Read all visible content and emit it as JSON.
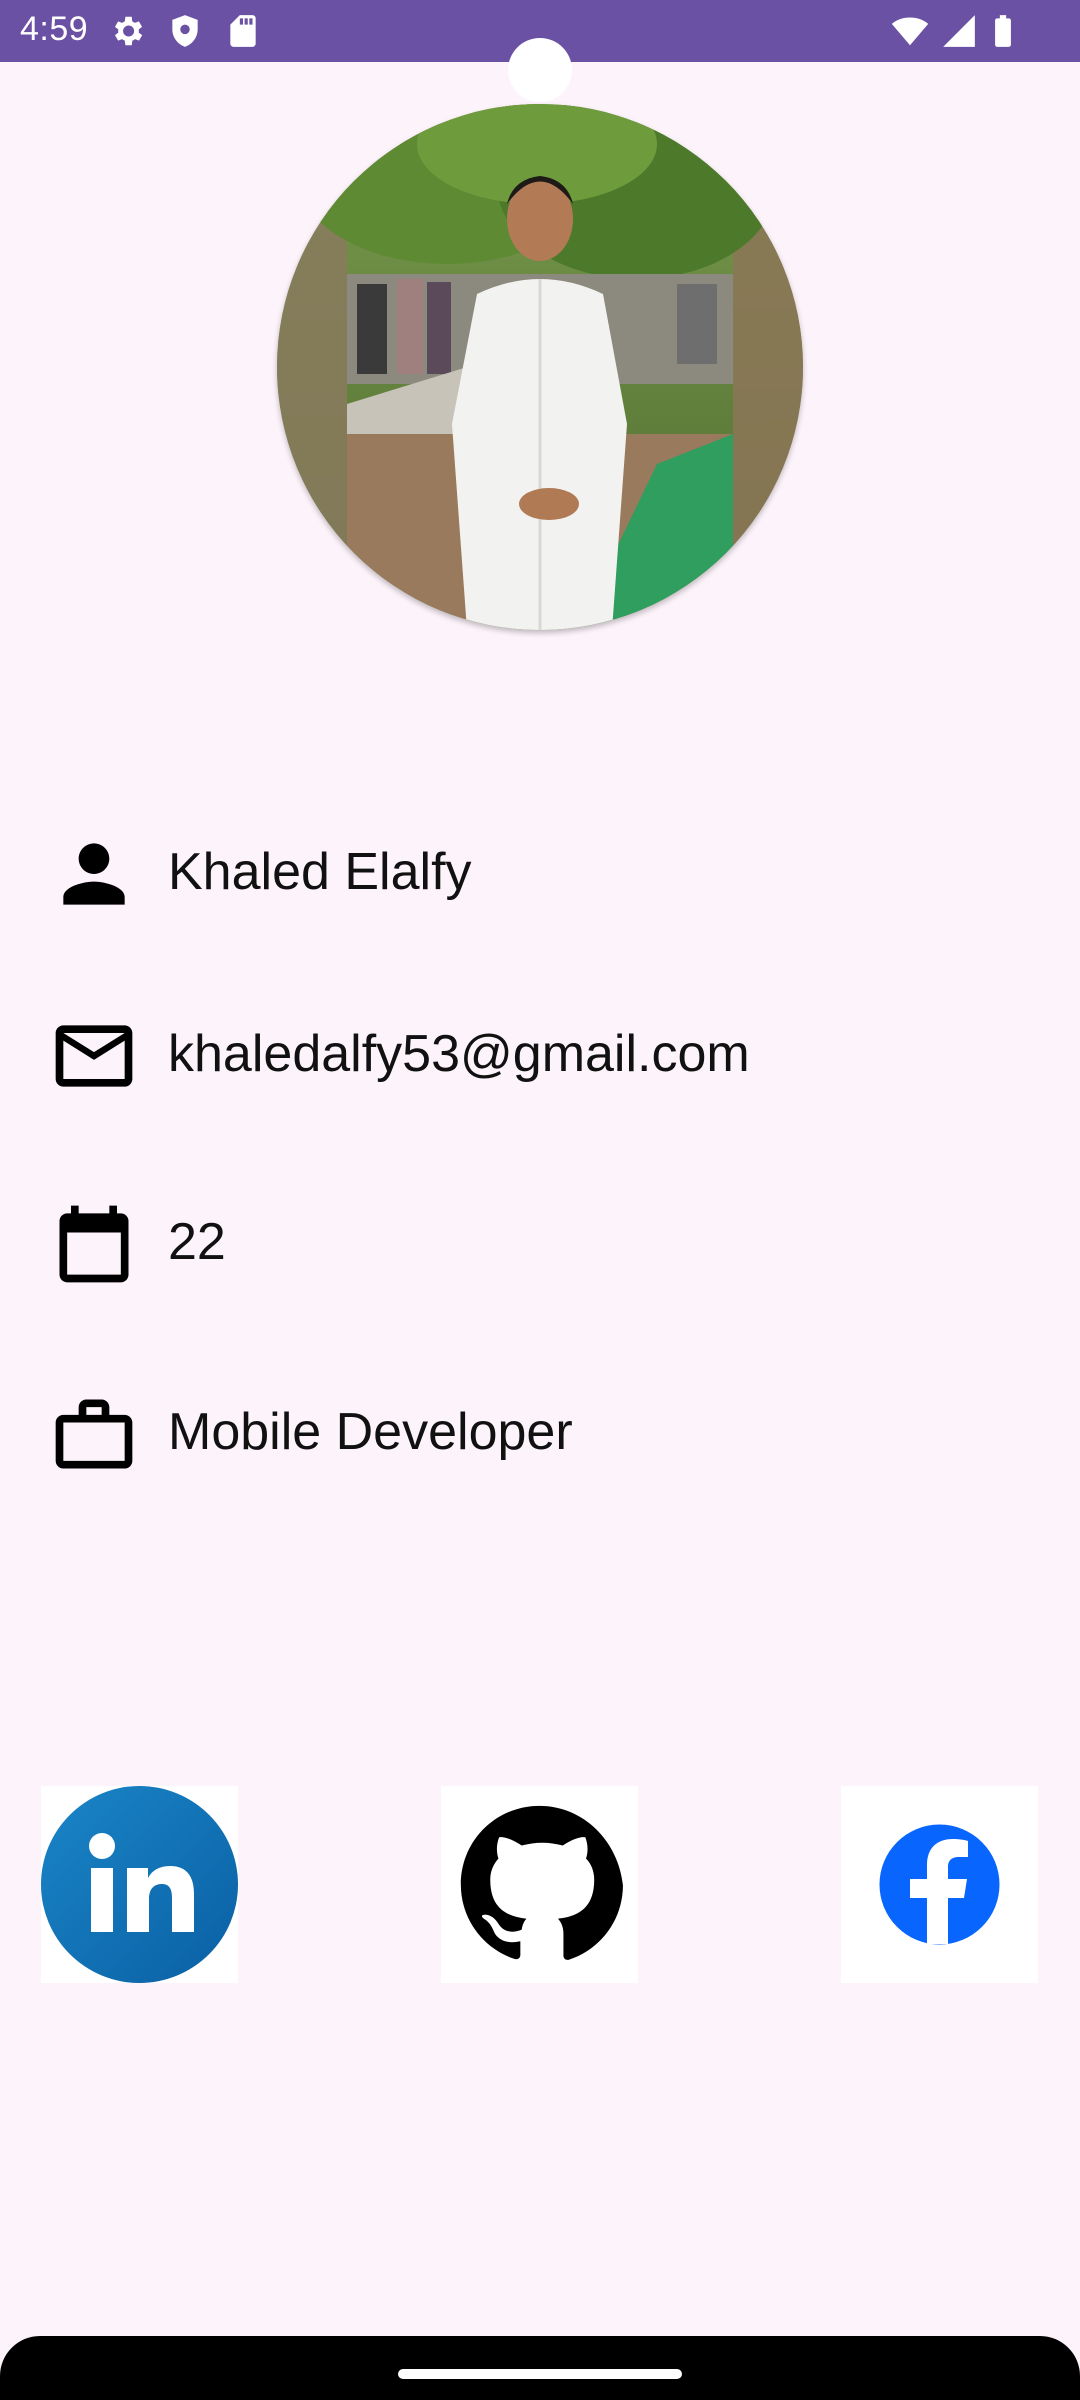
{
  "status_bar": {
    "time": "4:59",
    "icons": [
      "gear-icon",
      "shield-icon",
      "sd-card-icon",
      "wifi-icon",
      "signal-icon",
      "battery-icon"
    ],
    "background": "#6a51a4"
  },
  "profile": {
    "avatar": "profile-photo",
    "name": "Khaled Elalfy",
    "email": "khaledalfy53@gmail.com",
    "age": "22",
    "job": "Mobile Developer",
    "icons": {
      "name": "person-icon",
      "email": "mail-icon",
      "age": "calendar-icon",
      "job": "briefcase-icon"
    }
  },
  "social": {
    "items": [
      {
        "icon": "linkedin-icon",
        "color": "#0a66c2"
      },
      {
        "icon": "github-icon",
        "color": "#000000"
      },
      {
        "icon": "facebook-icon",
        "color": "#0866ff"
      }
    ]
  },
  "colors": {
    "background": "#fdf4fb",
    "text": "#111111"
  }
}
